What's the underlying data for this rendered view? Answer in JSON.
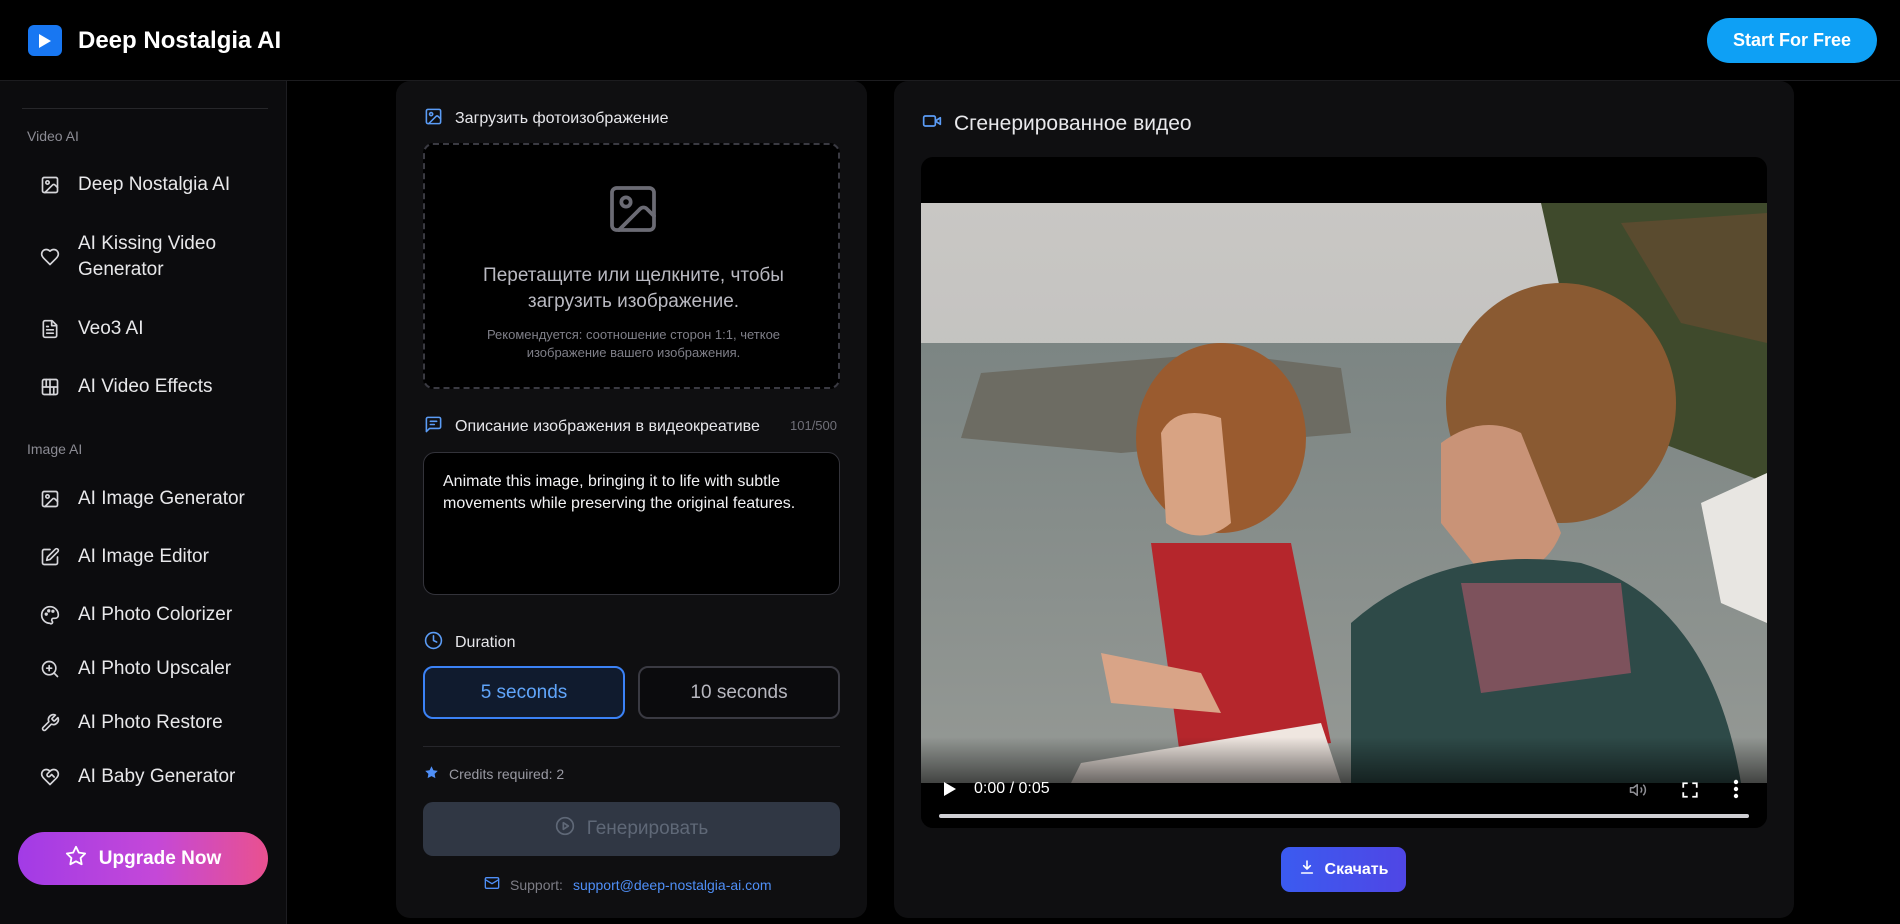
{
  "header": {
    "brand_name": "Deep Nostalgia AI",
    "cta_label": "Start For Free",
    "logo_icon": "play-icon",
    "accent_color": "#0ea0f5"
  },
  "sidebar": {
    "sections": [
      {
        "title": "Video AI",
        "items": [
          {
            "label": "Deep Nostalgia AI",
            "icon": "image-icon"
          },
          {
            "label": "AI Kissing Video Generator",
            "icon": "heart-icon"
          },
          {
            "label": "Veo3 AI",
            "icon": "document-icon"
          },
          {
            "label": "AI Video Effects",
            "icon": "layout-icon"
          }
        ]
      },
      {
        "title": "Image AI",
        "items": [
          {
            "label": "AI Image Generator",
            "icon": "image-icon"
          },
          {
            "label": "AI Image Editor",
            "icon": "edit-icon"
          },
          {
            "label": "AI Photo Colorizer",
            "icon": "palette-icon"
          },
          {
            "label": "AI Photo Upscaler",
            "icon": "zoom-in-icon"
          },
          {
            "label": "AI Photo Restore",
            "icon": "wrench-icon"
          },
          {
            "label": "AI Baby Generator",
            "icon": "heart-handshake-icon"
          }
        ]
      }
    ],
    "upgrade_label": "Upgrade Now"
  },
  "form": {
    "upload_label": "Загрузить фотоизображение",
    "dropzone_main": "Перетащите или щелкните, чтобы загрузить изображение.",
    "dropzone_hint": "Рекомендуется: соотношение сторон 1:1, четкое изображение вашего изображения.",
    "prompt_label": "Описание изображения в видеокреативе",
    "prompt_counter": "101/500",
    "prompt_value": "Animate this image, bringing it to life with subtle movements while preserving the original features.",
    "duration_label": "Duration",
    "duration_options": [
      "5 seconds",
      "10 seconds"
    ],
    "duration_selected": "5 seconds",
    "credits_text": "Credits required: 2",
    "generate_label": "Генерировать",
    "support_label": "Support:",
    "support_email": "support@deep-nostalgia-ai.com"
  },
  "video": {
    "title": "Сгенерированное видео",
    "time": "0:00 / 0:05",
    "download_label": "Скачать"
  }
}
